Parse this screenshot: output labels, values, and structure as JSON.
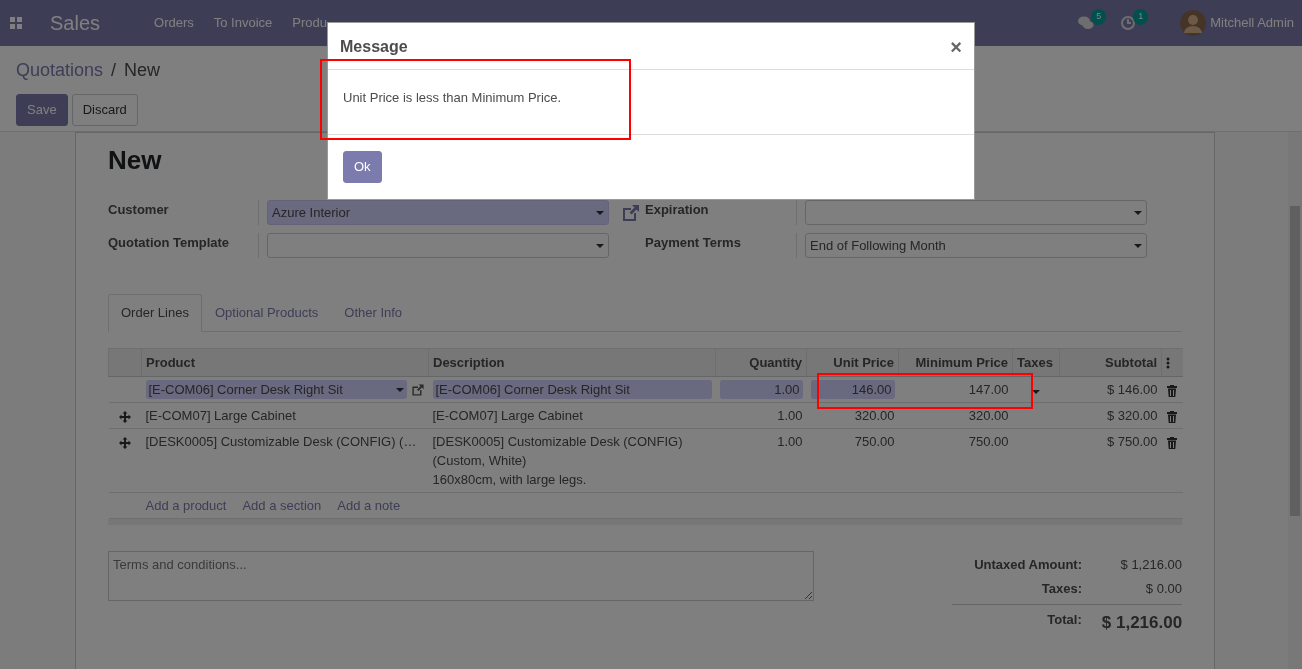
{
  "navbar": {
    "app_name": "Sales",
    "menu": [
      "Orders",
      "To Invoice",
      "Produ"
    ],
    "messages_count": "5",
    "activities_count": "1",
    "user": "Mitchell Admin"
  },
  "breadcrumb": [
    "Quotations",
    "New"
  ],
  "breadcrumb_separator": "/",
  "buttons": [
    "Save",
    "Discard"
  ],
  "form": {
    "title": "New",
    "left_fields": [
      {
        "label": "Customer",
        "value": "Azure Interior",
        "focused": true,
        "external_link": true
      },
      {
        "label": "Quotation Template",
        "focused": false,
        "external_link": false
      }
    ],
    "right_fields": [
      {
        "label": "Expiration",
        "focused": false
      },
      {
        "label": "Payment Terms",
        "value": "End of Following Month",
        "focused": false
      }
    ]
  },
  "tabs": [
    {
      "label": "Order Lines",
      "selected": true
    },
    {
      "label": "Optional Products",
      "selected": false
    },
    {
      "label": "Other Info",
      "selected": false
    }
  ],
  "table": {
    "columns": [
      "Product",
      "Description",
      "Quantity",
      "Unit Price",
      "Minimum Price",
      "Taxes",
      "Subtotal"
    ],
    "rows": [
      {
        "editing": true,
        "highlighted": true,
        "product": "[E-COM06] Corner Desk Right Sit",
        "description": [
          "[E-COM06] Corner Desk Right Sit"
        ],
        "quantity": "1.00",
        "unit_price": "146.00",
        "minimum_price": "147.00",
        "subtotal": "$ 146.00"
      },
      {
        "editing": false,
        "highlighted": false,
        "product": "[E-COM07] Large Cabinet",
        "description": [
          "[E-COM07] Large Cabinet"
        ],
        "quantity": "1.00",
        "unit_price": "320.00",
        "minimum_price": "320.00",
        "subtotal": "$ 320.00"
      },
      {
        "editing": false,
        "highlighted": false,
        "product": "[DESK0005] Customizable Desk (CONFIG) (…",
        "description": [
          "[DESK0005] Customizable Desk (CONFIG)",
          "(Custom, White)",
          "160x80cm, with large legs."
        ],
        "quantity": "1.00",
        "unit_price": "750.00",
        "minimum_price": "750.00",
        "subtotal": "$ 750.00"
      }
    ],
    "add_links": [
      "Add a product",
      "Add a section",
      "Add a note"
    ]
  },
  "terms": {
    "placeholder": "Terms and conditions..."
  },
  "totals": [
    {
      "label": "Untaxed Amount:",
      "value": "$ 1,216.00",
      "grand": false
    },
    {
      "label": "Taxes:",
      "value": "$ 0.00",
      "grand": false
    },
    {
      "label": "Total:",
      "value": "$ 1,216.00",
      "grand": true
    }
  ],
  "modal": {
    "title": "Message",
    "message": "Unit Price is less than Minimum Price.",
    "highlighted": true,
    "close": "×",
    "button": "Ok"
  }
}
